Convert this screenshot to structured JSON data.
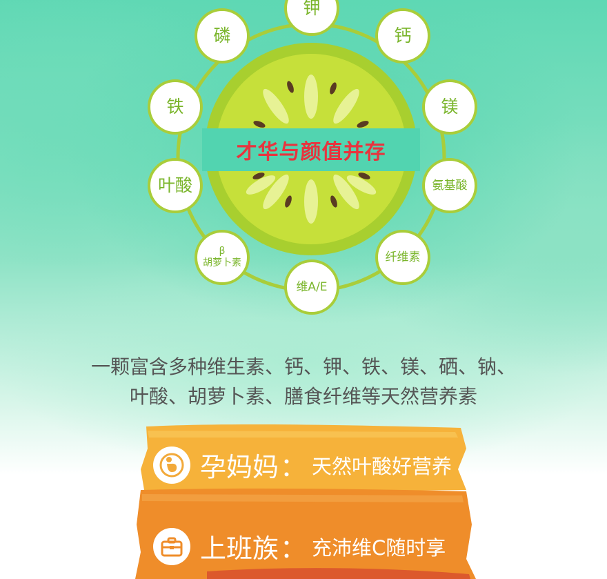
{
  "infographic": {
    "banner_title": "才华与颜值并存",
    "nutrients": {
      "top": "钾",
      "calcium": "钙",
      "magnesium": "镁",
      "amino": "氨基酸",
      "fiber": "纤维素",
      "vitamin_ae": "维A/E",
      "beta_symbol": "β",
      "carotene": "胡萝卜素",
      "folic": "叶酸",
      "iron": "铁",
      "phosphorus": "磷"
    },
    "description_line1": "一颗富含多种维生素、钙、钾、铁、镁、硒、钠、",
    "description_line2": "叶酸、胡萝卜素、膳食纤维等天然营养素"
  },
  "audiences": [
    {
      "title": "孕妈妈",
      "colon": "：",
      "benefit": "天然叶酸好营养",
      "icon": "pregnant-woman-icon"
    },
    {
      "title": "上班族",
      "colon": "：",
      "benefit": "充沛维C随时享",
      "icon": "briefcase-icon"
    }
  ],
  "colors": {
    "ring": "#a9cd3a",
    "node_text": "#7ab52b",
    "banner_bg": "#52d4b0",
    "banner_text": "#e8343e",
    "stripe_yellow": "#f6b23a",
    "stripe_orange": "#ef8d2a"
  }
}
